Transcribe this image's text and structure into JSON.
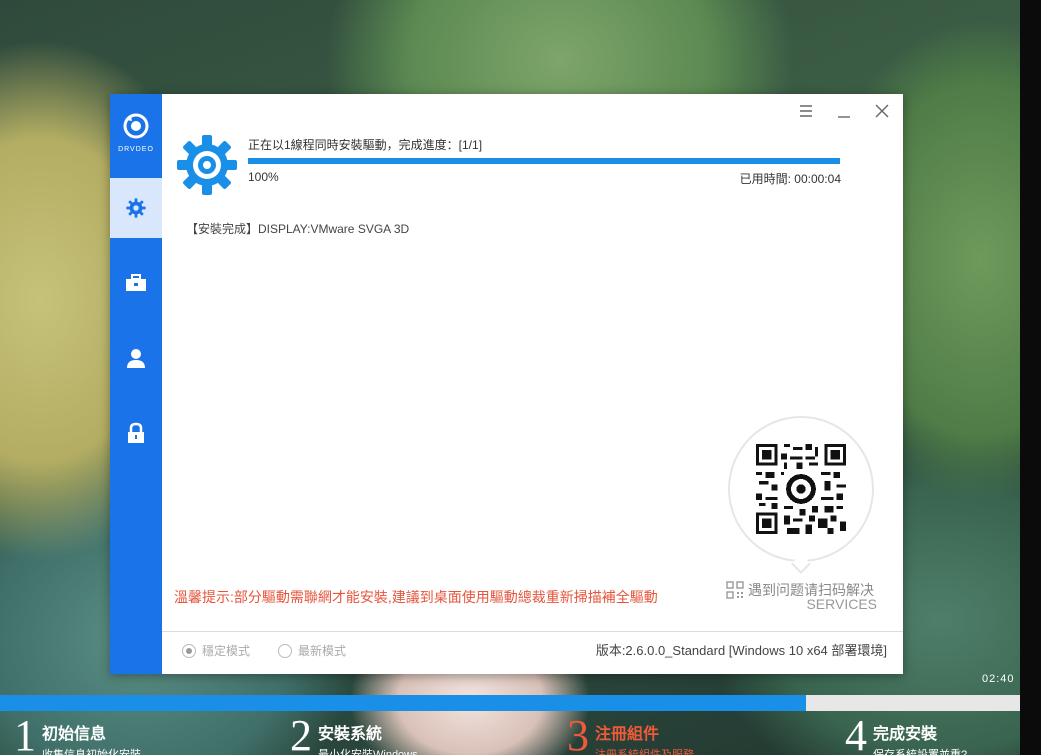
{
  "app": {
    "logo_text": "DRVDEO"
  },
  "install": {
    "status": "正在以1線程同時安裝驅動，完成進度：[1/1]",
    "progress_percent": 100,
    "progress_label": "100%",
    "elapsed": "已用時間: 00:00:04",
    "log": "【安裝完成】DISPLAY:VMware SVGA 3D"
  },
  "service": {
    "qr_label": "遇到问题请扫码解决",
    "qr_sub": "SERVICES"
  },
  "hint": "溫馨提示:部分驅動需聯網才能安裝,建議到桌面使用驅動總裁重新掃描補全驅動",
  "footer": {
    "mode_stable": "穩定模式",
    "mode_latest": "最新模式",
    "version": "版本:2.6.0.0_Standard [Windows 10 x64 部署環境]"
  },
  "bottom": {
    "time": "02:40",
    "progress_percent": 79,
    "steps": [
      {
        "num": "1",
        "title": "初始信息",
        "sub": "收集信息初始化安裝"
      },
      {
        "num": "2",
        "title": "安裝系統",
        "sub": "最小化安裝Windows"
      },
      {
        "num": "3",
        "title": "注冊組件",
        "sub": "注冊系統組件及服務"
      },
      {
        "num": "4",
        "title": "完成安裝",
        "sub": "保存系統設置並重?"
      }
    ]
  },
  "colors": {
    "accent": "#1a73e8",
    "progress": "#1a8fe8",
    "warning": "#e7553d"
  }
}
